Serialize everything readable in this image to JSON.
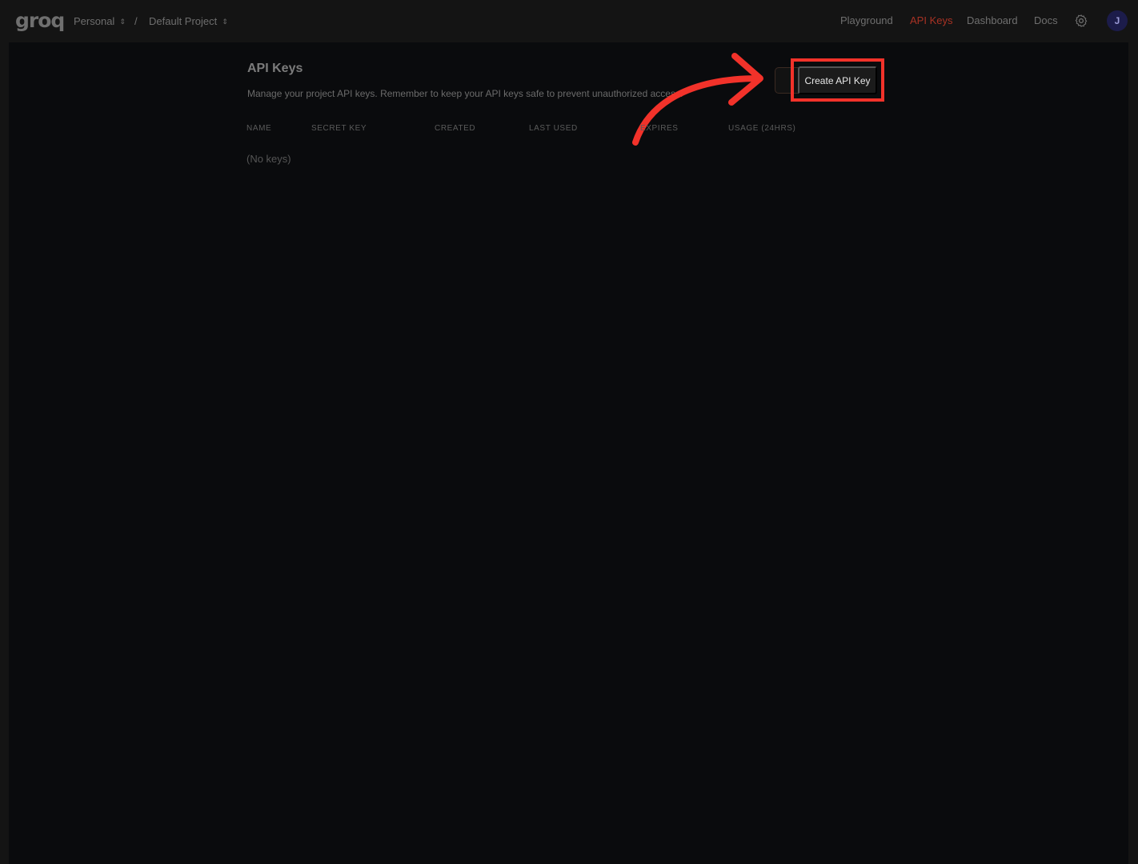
{
  "header": {
    "logo": "groq",
    "org": "Personal",
    "separator": "/",
    "project": "Default Project",
    "nav": [
      "Playground",
      "API Keys",
      "Dashboard",
      "Docs"
    ],
    "active_nav": "API Keys",
    "avatar_initial": "J"
  },
  "page": {
    "title": "API Keys",
    "description": "Manage your project API keys. Remember to keep your API keys safe to prevent unauthorized access.",
    "create_button": "Create API Key",
    "columns": [
      "NAME",
      "SECRET KEY",
      "CREATED",
      "LAST USED",
      "EXPIRES",
      "USAGE (24HRS)"
    ],
    "empty_text": "(No keys)"
  },
  "annotation": {
    "color": "#f2322a"
  }
}
